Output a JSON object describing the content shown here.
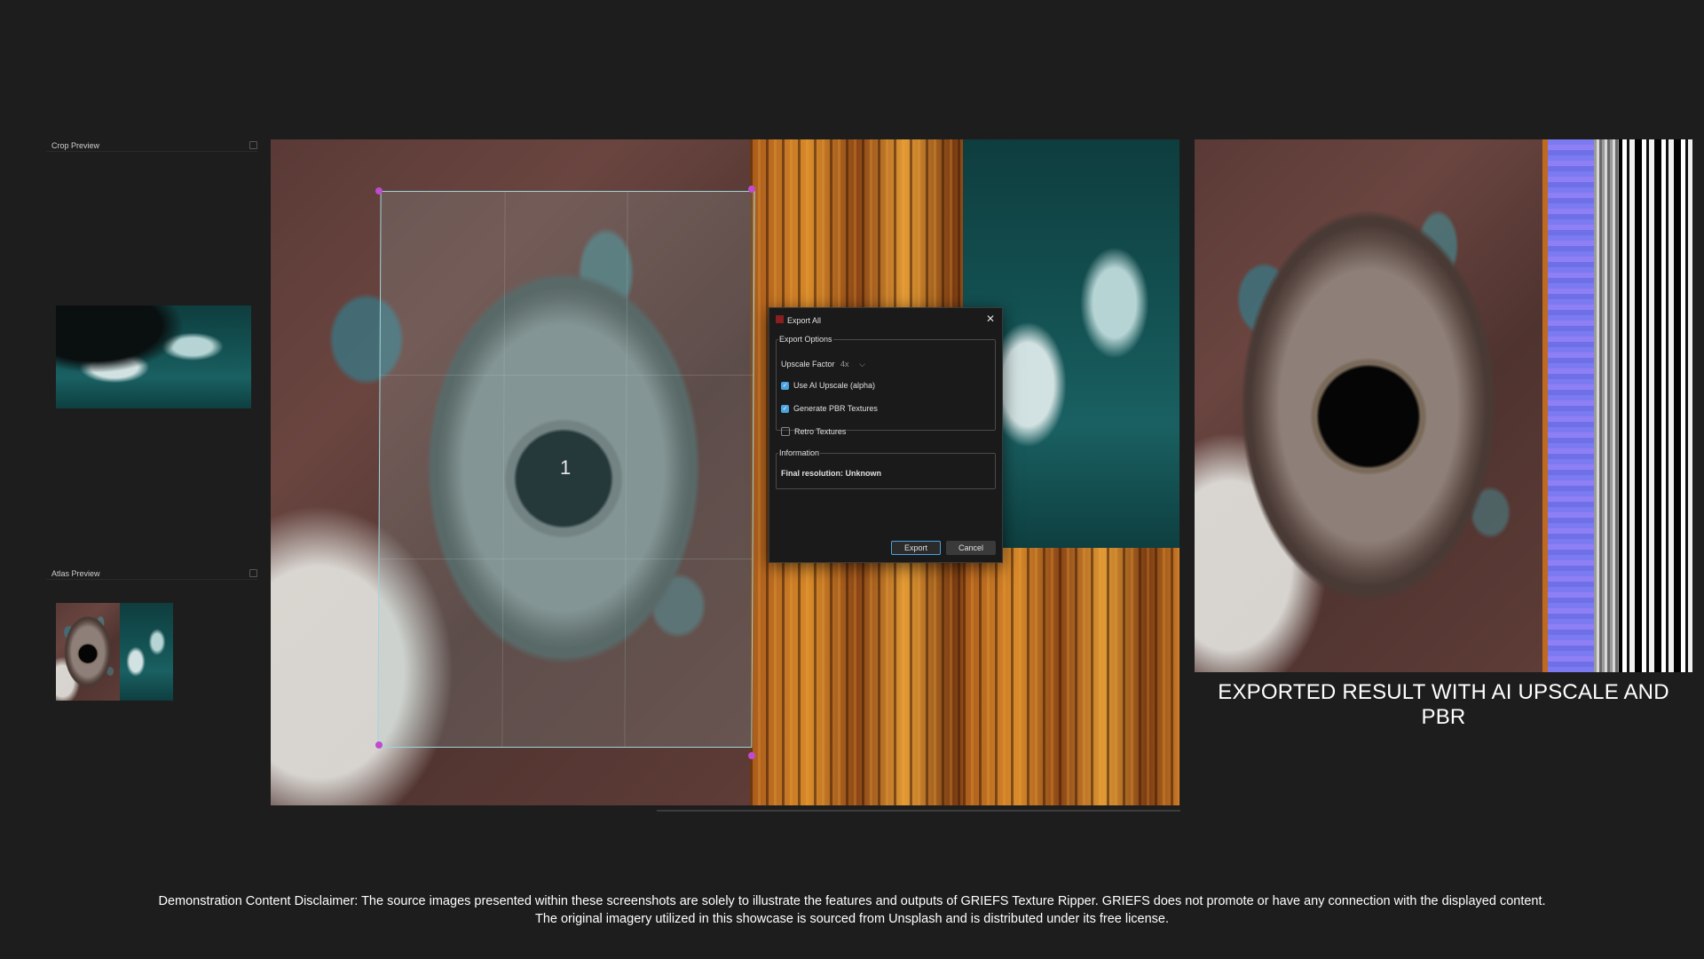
{
  "crop_preview": {
    "title": "Crop Preview"
  },
  "atlas_preview": {
    "title": "Atlas Preview"
  },
  "canvas": {
    "crop_number": "1"
  },
  "export_dialog": {
    "title": "Export All",
    "export_options_legend": "Export Options",
    "upscale_factor_label": "Upscale Factor",
    "upscale_factor_value": "4x",
    "use_ai_upscale_label": "Use AI Upscale (alpha)",
    "use_ai_upscale_checked": true,
    "generate_pbr_label": "Generate PBR Textures",
    "generate_pbr_checked": true,
    "retro_textures_label": "Retro Textures",
    "retro_textures_checked": false,
    "information_legend": "Information",
    "final_resolution_text": "Final resolution: Unknown",
    "export_button": "Export",
    "cancel_button": "Cancel"
  },
  "result": {
    "caption": "EXPORTED RESULT WITH AI UPSCALE AND PBR"
  },
  "disclaimer": {
    "line1": "Demonstration Content Disclaimer: The source images presented within these screenshots are solely to illustrate the features and outputs of GRIEFS Texture Ripper. GRIEFS does not promote or have any connection with the displayed content.",
    "line2": "The original imagery utilized in this showcase is sourced from Unsplash and is distributed under its free license."
  },
  "colors": {
    "background": "#1d1d1d",
    "accent": "#4aa3df",
    "crop_border": "#9fd6db",
    "handle": "#c04ad0"
  }
}
